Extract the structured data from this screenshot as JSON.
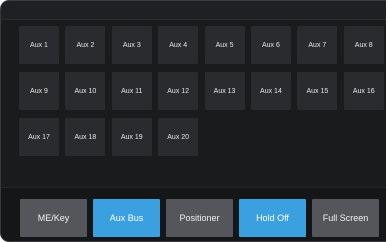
{
  "aux_buttons": [
    "Aux 1",
    "Aux 2",
    "Aux 3",
    "Aux 4",
    "Aux 5",
    "Aux 6",
    "Aux 7",
    "Aux 8",
    "Aux 9",
    "Aux 10",
    "Aux 11",
    "Aux 12",
    "Aux 13",
    "Aux 14",
    "Aux 15",
    "Aux 16",
    "Aux 17",
    "Aux 18",
    "Aux 19",
    "Aux 20"
  ],
  "toolbar": {
    "buttons": [
      {
        "label": "ME/Key",
        "active": false
      },
      {
        "label": "Aux Bus",
        "active": true
      },
      {
        "label": "Positioner",
        "active": false
      },
      {
        "label": "Hold Off",
        "active": true
      },
      {
        "label": "Full Screen",
        "active": false
      }
    ]
  },
  "colors": {
    "panel_bg": "#1a1b1d",
    "button_bg": "#2a2b2e",
    "toolbar_button_bg": "#55565b",
    "active_accent": "#3aa0e0"
  }
}
